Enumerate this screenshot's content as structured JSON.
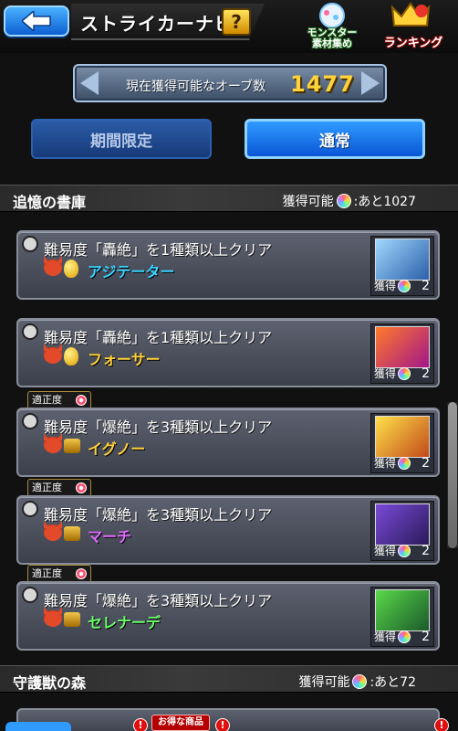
{
  "header": {
    "title": "ストライカーナビ",
    "help_label": "?",
    "shortcut_materials": "モンスター\n素材集め",
    "shortcut_ranking": "ランキング"
  },
  "orbs": {
    "label": "現在獲得可能なオーブ数",
    "count": "1477"
  },
  "tabs": [
    {
      "label": "期間限定",
      "active": false
    },
    {
      "label": "通常",
      "active": true
    }
  ],
  "sections": [
    {
      "title": "追憶の書庫",
      "status_prefix": "獲得可能",
      "status_suffix": ":あと1027"
    },
    {
      "title": "守護獣の森",
      "status_prefix": "獲得可能",
      "status_suffix": ":あと72"
    }
  ],
  "missions": [
    {
      "text": "難易度「轟絶」を1種類以上クリア",
      "monster": "アジテーター",
      "monster_color": "#39d3ff",
      "rate_tag": "",
      "reward_label": "獲得",
      "reward_count": "2",
      "reward_colors": [
        "#9fd8ff",
        "#2b5fa8"
      ],
      "icon": "egg"
    },
    {
      "text": "難易度「轟絶」を1種類以上クリア",
      "monster": "フォーサー",
      "monster_color": "#ffd23a",
      "rate_tag": "",
      "reward_label": "獲得",
      "reward_count": "2",
      "reward_colors": [
        "#ff7a2a",
        "#a3168a"
      ],
      "icon": "egg"
    },
    {
      "text": "難易度「爆絶」を3種類以上クリア",
      "monster": "イグノー",
      "monster_color": "#ffd23a",
      "rate_tag": "適正度",
      "reward_label": "獲得",
      "reward_count": "2",
      "reward_colors": [
        "#ffe14a",
        "#c24a1a"
      ],
      "icon": "chest"
    },
    {
      "text": "難易度「爆絶」を3種類以上クリア",
      "monster": "マーチ",
      "monster_color": "#e26bff",
      "rate_tag": "適正度",
      "reward_label": "獲得",
      "reward_count": "2",
      "reward_colors": [
        "#7a4ad8",
        "#2a1a5a"
      ],
      "icon": "chest"
    },
    {
      "text": "難易度「爆絶」を3種類以上クリア",
      "monster": "セレナーデ",
      "monster_color": "#6bff6b",
      "rate_tag": "適正度",
      "reward_label": "獲得",
      "reward_count": "2",
      "reward_colors": [
        "#5ad84a",
        "#1a5a2a"
      ],
      "icon": "chest"
    }
  ],
  "bottom": {
    "deal_tag": "お得な商品",
    "alert": "!"
  }
}
